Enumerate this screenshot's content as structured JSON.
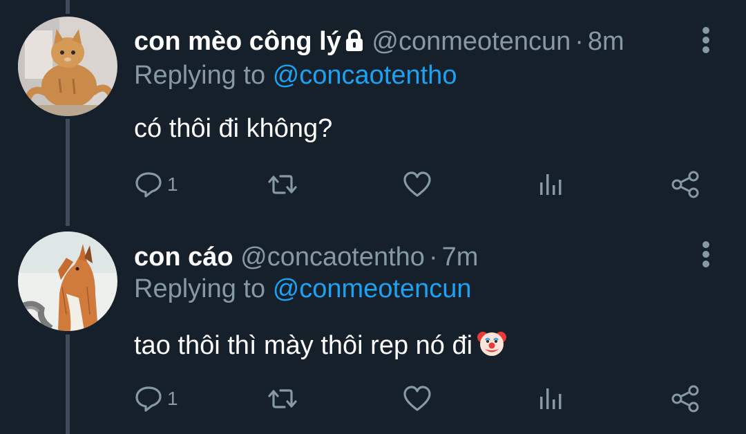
{
  "colors": {
    "background": "#15202b",
    "secondary_text": "#8899a6",
    "mention": "#1da1f2",
    "thread_line": "#3d4b5a"
  },
  "tweets": [
    {
      "display_name": "con mèo công lý",
      "locked_icon": "lock-icon",
      "handle": "@conmeotencun",
      "separator": "·",
      "time": "8m",
      "replying_prefix": "Replying to",
      "replying_to": "@concaotentho",
      "text": "có thôi đi không?",
      "reply_count": "1",
      "avatar": "cat-avatar"
    },
    {
      "display_name": "con cáo",
      "handle": "@concaotentho",
      "separator": "·",
      "time": "7m",
      "replying_prefix": "Replying to",
      "replying_to": "@conmeotencun",
      "text": "tao thôi thì mày thôi rep nó đi",
      "emoji_icon": "clown-face-icon",
      "reply_count": "1",
      "avatar": "fox-avatar"
    }
  ],
  "action_icons": [
    "reply-icon",
    "retweet-icon",
    "like-icon",
    "analytics-icon",
    "share-icon"
  ]
}
